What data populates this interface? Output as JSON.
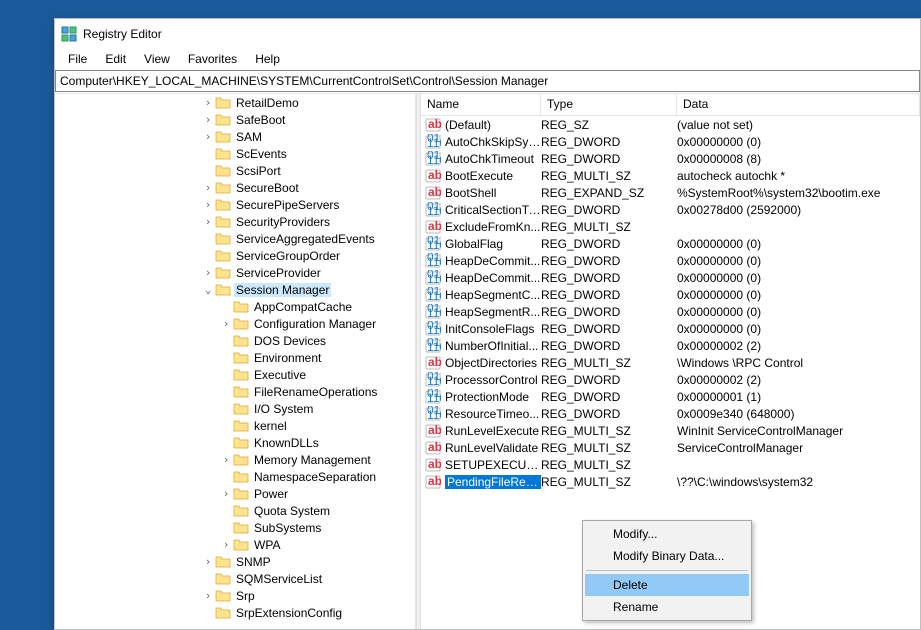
{
  "window": {
    "title": "Registry Editor"
  },
  "menu": {
    "items": [
      "File",
      "Edit",
      "View",
      "Favorites",
      "Help"
    ]
  },
  "address": "Computer\\HKEY_LOCAL_MACHINE\\SYSTEM\\CurrentControlSet\\Control\\Session Manager",
  "tree": {
    "items": [
      {
        "depth": 3,
        "exp": ">",
        "label": "RetailDemo"
      },
      {
        "depth": 3,
        "exp": ">",
        "label": "SafeBoot"
      },
      {
        "depth": 3,
        "exp": ">",
        "label": "SAM"
      },
      {
        "depth": 3,
        "exp": "",
        "label": "ScEvents"
      },
      {
        "depth": 3,
        "exp": "",
        "label": "ScsiPort"
      },
      {
        "depth": 3,
        "exp": ">",
        "label": "SecureBoot"
      },
      {
        "depth": 3,
        "exp": ">",
        "label": "SecurePipeServers"
      },
      {
        "depth": 3,
        "exp": ">",
        "label": "SecurityProviders"
      },
      {
        "depth": 3,
        "exp": "",
        "label": "ServiceAggregatedEvents"
      },
      {
        "depth": 3,
        "exp": "",
        "label": "ServiceGroupOrder"
      },
      {
        "depth": 3,
        "exp": ">",
        "label": "ServiceProvider"
      },
      {
        "depth": 3,
        "exp": "v",
        "label": "Session Manager",
        "selected": true
      },
      {
        "depth": 4,
        "exp": "",
        "label": "AppCompatCache"
      },
      {
        "depth": 4,
        "exp": ">",
        "label": "Configuration Manager"
      },
      {
        "depth": 4,
        "exp": "",
        "label": "DOS Devices"
      },
      {
        "depth": 4,
        "exp": "",
        "label": "Environment"
      },
      {
        "depth": 4,
        "exp": "",
        "label": "Executive"
      },
      {
        "depth": 4,
        "exp": "",
        "label": "FileRenameOperations"
      },
      {
        "depth": 4,
        "exp": "",
        "label": "I/O System"
      },
      {
        "depth": 4,
        "exp": "",
        "label": "kernel"
      },
      {
        "depth": 4,
        "exp": "",
        "label": "KnownDLLs"
      },
      {
        "depth": 4,
        "exp": ">",
        "label": "Memory Management"
      },
      {
        "depth": 4,
        "exp": "",
        "label": "NamespaceSeparation"
      },
      {
        "depth": 4,
        "exp": ">",
        "label": "Power"
      },
      {
        "depth": 4,
        "exp": "",
        "label": "Quota System"
      },
      {
        "depth": 4,
        "exp": "",
        "label": "SubSystems"
      },
      {
        "depth": 4,
        "exp": ">",
        "label": "WPA"
      },
      {
        "depth": 3,
        "exp": ">",
        "label": "SNMP"
      },
      {
        "depth": 3,
        "exp": "",
        "label": "SQMServiceList"
      },
      {
        "depth": 3,
        "exp": ">",
        "label": "Srp"
      },
      {
        "depth": 3,
        "exp": "",
        "label": "SrpExtensionConfig"
      }
    ]
  },
  "list": {
    "headers": {
      "name": "Name",
      "type": "Type",
      "data": "Data"
    },
    "rows": [
      {
        "icon": "sz",
        "name": "(Default)",
        "type": "REG_SZ",
        "data": "(value not set)"
      },
      {
        "icon": "bin",
        "name": "AutoChkSkipSys...",
        "type": "REG_DWORD",
        "data": "0x00000000 (0)"
      },
      {
        "icon": "bin",
        "name": "AutoChkTimeout",
        "type": "REG_DWORD",
        "data": "0x00000008 (8)"
      },
      {
        "icon": "sz",
        "name": "BootExecute",
        "type": "REG_MULTI_SZ",
        "data": "autocheck autochk *"
      },
      {
        "icon": "sz",
        "name": "BootShell",
        "type": "REG_EXPAND_SZ",
        "data": "%SystemRoot%\\system32\\bootim.exe"
      },
      {
        "icon": "bin",
        "name": "CriticalSectionTi...",
        "type": "REG_DWORD",
        "data": "0x00278d00 (2592000)"
      },
      {
        "icon": "sz",
        "name": "ExcludeFromKn...",
        "type": "REG_MULTI_SZ",
        "data": ""
      },
      {
        "icon": "bin",
        "name": "GlobalFlag",
        "type": "REG_DWORD",
        "data": "0x00000000 (0)"
      },
      {
        "icon": "bin",
        "name": "HeapDeCommit...",
        "type": "REG_DWORD",
        "data": "0x00000000 (0)"
      },
      {
        "icon": "bin",
        "name": "HeapDeCommit...",
        "type": "REG_DWORD",
        "data": "0x00000000 (0)"
      },
      {
        "icon": "bin",
        "name": "HeapSegmentC...",
        "type": "REG_DWORD",
        "data": "0x00000000 (0)"
      },
      {
        "icon": "bin",
        "name": "HeapSegmentR...",
        "type": "REG_DWORD",
        "data": "0x00000000 (0)"
      },
      {
        "icon": "bin",
        "name": "InitConsoleFlags",
        "type": "REG_DWORD",
        "data": "0x00000000 (0)"
      },
      {
        "icon": "bin",
        "name": "NumberOfInitial...",
        "type": "REG_DWORD",
        "data": "0x00000002 (2)"
      },
      {
        "icon": "sz",
        "name": "ObjectDirectories",
        "type": "REG_MULTI_SZ",
        "data": "\\Windows \\RPC Control"
      },
      {
        "icon": "bin",
        "name": "ProcessorControl",
        "type": "REG_DWORD",
        "data": "0x00000002 (2)"
      },
      {
        "icon": "bin",
        "name": "ProtectionMode",
        "type": "REG_DWORD",
        "data": "0x00000001 (1)"
      },
      {
        "icon": "bin",
        "name": "ResourceTimeo...",
        "type": "REG_DWORD",
        "data": "0x0009e340 (648000)"
      },
      {
        "icon": "sz",
        "name": "RunLevelExecute",
        "type": "REG_MULTI_SZ",
        "data": "WinInit ServiceControlManager"
      },
      {
        "icon": "sz",
        "name": "RunLevelValidate",
        "type": "REG_MULTI_SZ",
        "data": "ServiceControlManager"
      },
      {
        "icon": "sz",
        "name": "SETUPEXECUTE",
        "type": "REG_MULTI_SZ",
        "data": ""
      },
      {
        "icon": "sz",
        "name": "PendingFileRen...",
        "type": "REG_MULTI_SZ",
        "data": "\\??\\C:\\windows\\system32",
        "selected": true
      }
    ]
  },
  "context_menu": {
    "items": [
      {
        "label": "Modify...",
        "sep": false
      },
      {
        "label": "Modify Binary Data...",
        "sep": true
      },
      {
        "label": "Delete",
        "sep": false,
        "highlight": true
      },
      {
        "label": "Rename",
        "sep": false
      }
    ]
  }
}
